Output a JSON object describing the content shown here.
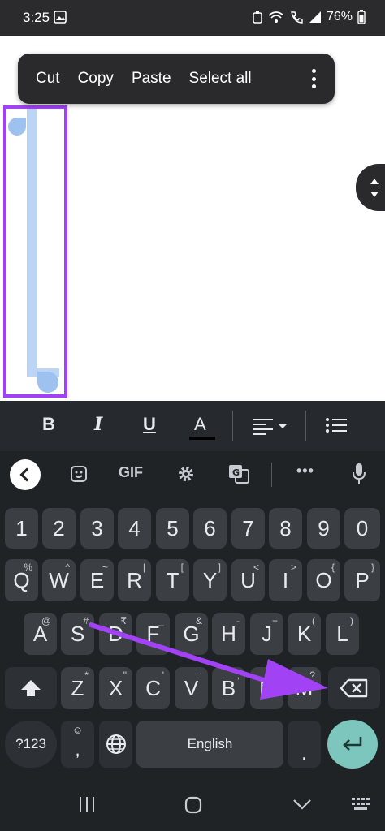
{
  "status_bar": {
    "time": "3:25",
    "battery": "76%"
  },
  "context_menu": {
    "items": [
      "Cut",
      "Copy",
      "Paste",
      "Select all"
    ]
  },
  "format_toolbar": {
    "bold": "B",
    "italic": "I",
    "underline": "U",
    "text_color": "A"
  },
  "keyboard": {
    "toolbar": {
      "gif": "GIF",
      "more": "•••"
    },
    "number_row": [
      "1",
      "2",
      "3",
      "4",
      "5",
      "6",
      "7",
      "8",
      "9",
      "0"
    ],
    "row1": [
      {
        "key": "Q",
        "hint": "%"
      },
      {
        "key": "W",
        "hint": "^"
      },
      {
        "key": "E",
        "hint": "~"
      },
      {
        "key": "R",
        "hint": "|"
      },
      {
        "key": "T",
        "hint": "["
      },
      {
        "key": "Y",
        "hint": "]"
      },
      {
        "key": "U",
        "hint": "<"
      },
      {
        "key": "I",
        "hint": ">"
      },
      {
        "key": "O",
        "hint": "{"
      },
      {
        "key": "P",
        "hint": "}"
      }
    ],
    "row2": [
      {
        "key": "A",
        "hint": "@"
      },
      {
        "key": "S",
        "hint": "#"
      },
      {
        "key": "D",
        "hint": "₹"
      },
      {
        "key": "F",
        "hint": "_"
      },
      {
        "key": "G",
        "hint": "&"
      },
      {
        "key": "H",
        "hint": "-"
      },
      {
        "key": "J",
        "hint": "+"
      },
      {
        "key": "K",
        "hint": "("
      },
      {
        "key": "L",
        "hint": ")"
      }
    ],
    "row3": [
      {
        "key": "Z",
        "hint": "*"
      },
      {
        "key": "X",
        "hint": "\""
      },
      {
        "key": "C",
        "hint": "'"
      },
      {
        "key": "V",
        "hint": ":"
      },
      {
        "key": "B",
        "hint": ";"
      },
      {
        "key": "N",
        "hint": "!"
      },
      {
        "key": "M",
        "hint": "?"
      }
    ],
    "symbols_key": "?123",
    "comma_key": ",",
    "period_key": ".",
    "space_label": "English"
  },
  "colors": {
    "selection_box": "#a142f4",
    "arrow": "#a142f4",
    "enter_key": "#7cc6bd"
  }
}
